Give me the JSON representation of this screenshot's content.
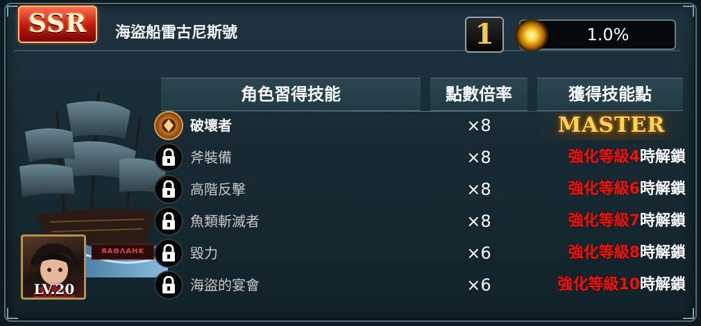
{
  "header": {
    "rarity": "SSR",
    "character_name": "海盜船雷古尼斯號",
    "count": "1",
    "rate": "1.0%"
  },
  "columns": {
    "skill": "角色習得技能",
    "rate": "點數倍率",
    "points": "獲得技能點"
  },
  "portrait": {
    "level": "LV.20",
    "banner_text": "ЯΑΘΛΑΗΚ"
  },
  "skills": [
    {
      "name": "破壞者",
      "multiplier": "×8",
      "status": "MASTER",
      "locked": false
    },
    {
      "name": "斧裝備",
      "multiplier": "×8",
      "unlock_red": "強化等級4",
      "unlock_white": "時解鎖",
      "locked": true
    },
    {
      "name": "高階反擊",
      "multiplier": "×8",
      "unlock_red": "強化等級6",
      "unlock_white": "時解鎖",
      "locked": true
    },
    {
      "name": "魚類斬滅者",
      "multiplier": "×8",
      "unlock_red": "強化等級7",
      "unlock_white": "時解鎖",
      "locked": true
    },
    {
      "name": "毀力",
      "multiplier": "×6",
      "unlock_red": "強化等級8",
      "unlock_white": "時解鎖",
      "locked": true
    },
    {
      "name": "海盜的宴會",
      "multiplier": "×6",
      "unlock_red": "強化等級10",
      "unlock_white": "時解鎖",
      "locked": true
    }
  ],
  "colors": {
    "panel": "#172a33",
    "unlock_red": "#e8140f",
    "master_gold": "#ffd45a",
    "badge_red": "#c0160c"
  },
  "icons": {
    "lock": "lock-icon",
    "skill": "destroyer-skill-icon",
    "rate": "star-burst-icon"
  }
}
